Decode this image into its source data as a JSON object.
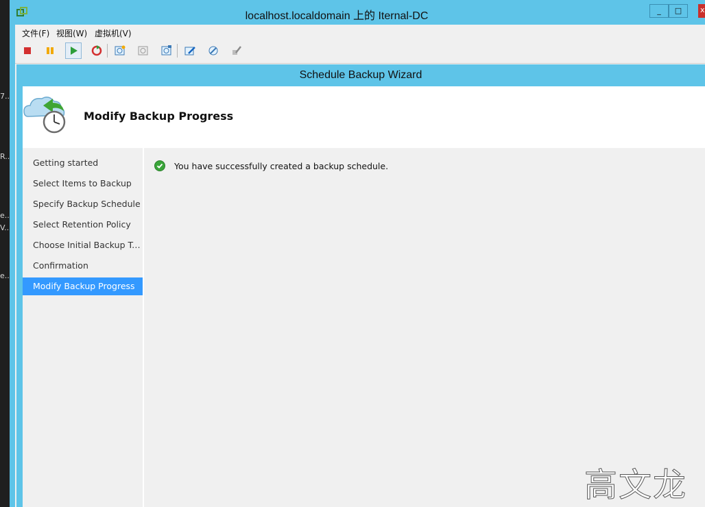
{
  "background": {
    "fragments": [
      "7...",
      "R...",
      "e...",
      "V...",
      "e..."
    ]
  },
  "console": {
    "title": "localhost.localdomain 上的 Iternal-DC",
    "window_buttons": {
      "minimize": "_",
      "restore": "□",
      "close": "x"
    },
    "menu": [
      "文件(F)",
      "视图(W)",
      "虚拟机(V)"
    ],
    "toolbar_icons": [
      "stop-icon",
      "pause-icon",
      "play-icon",
      "reset-icon",
      "snapshot-take-icon",
      "snapshot-revert-icon",
      "snapshot-manager-icon",
      "edit-settings-icon",
      "tools-icon",
      "tools2-icon"
    ]
  },
  "wizard": {
    "title": "Schedule Backup Wizard",
    "header_title": "Modify Backup Progress",
    "steps": [
      "Getting started",
      "Select Items to Backup",
      "Specify Backup Schedule",
      "Select Retention Policy",
      "Choose Initial Backup Type",
      "Confirmation",
      "Modify Backup Progress"
    ],
    "active_step": "Modify Backup Progress",
    "message": "You have successfully created a backup schedule."
  },
  "watermark": "高文龙",
  "colors": {
    "accent": "#5ec4e8",
    "selection": "#3399ff",
    "success": "#3aa53a"
  }
}
